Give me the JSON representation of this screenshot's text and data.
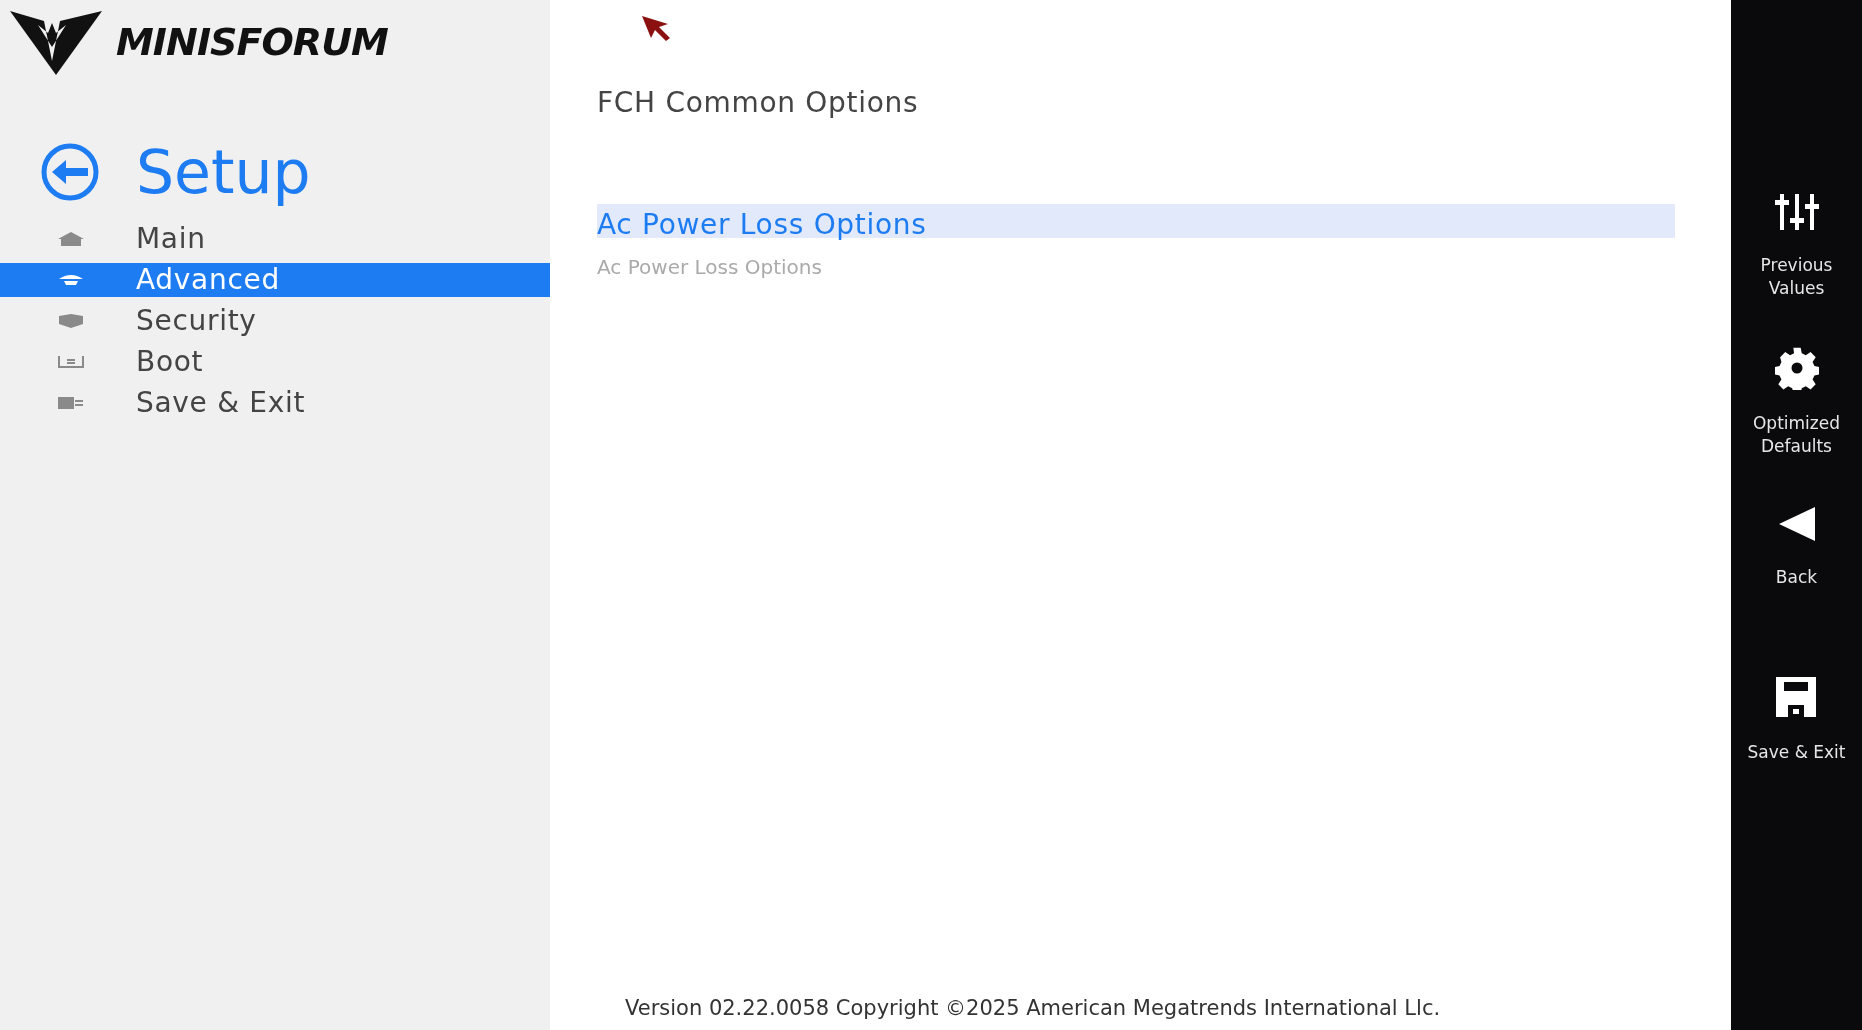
{
  "logo": {
    "text": "MINISFORUM"
  },
  "title": "Setup",
  "nav": [
    {
      "label": "Main",
      "kind": "home",
      "selected": false
    },
    {
      "label": "Advanced",
      "kind": "advanced",
      "selected": true
    },
    {
      "label": "Security",
      "kind": "security",
      "selected": false
    },
    {
      "label": "Boot",
      "kind": "boot",
      "selected": false
    },
    {
      "label": "Save & Exit",
      "kind": "exit",
      "selected": false
    }
  ],
  "page_title": "FCH Common Options",
  "options": [
    {
      "label": "Ac Power Loss Options",
      "selected": true
    }
  ],
  "help_text": "Ac Power Loss Options",
  "footer": "Version 02.22.0058 Copyright ©2025 American Megatrends International Llc.",
  "actions": [
    {
      "kind": "sliders",
      "lines": [
        "Previous",
        "Values"
      ]
    },
    {
      "kind": "gear",
      "lines": [
        "Optimized",
        "Defaults"
      ]
    },
    {
      "kind": "back",
      "lines": [
        "Back"
      ]
    },
    {
      "kind": "save",
      "lines": [
        "Save & Exit"
      ]
    }
  ]
}
